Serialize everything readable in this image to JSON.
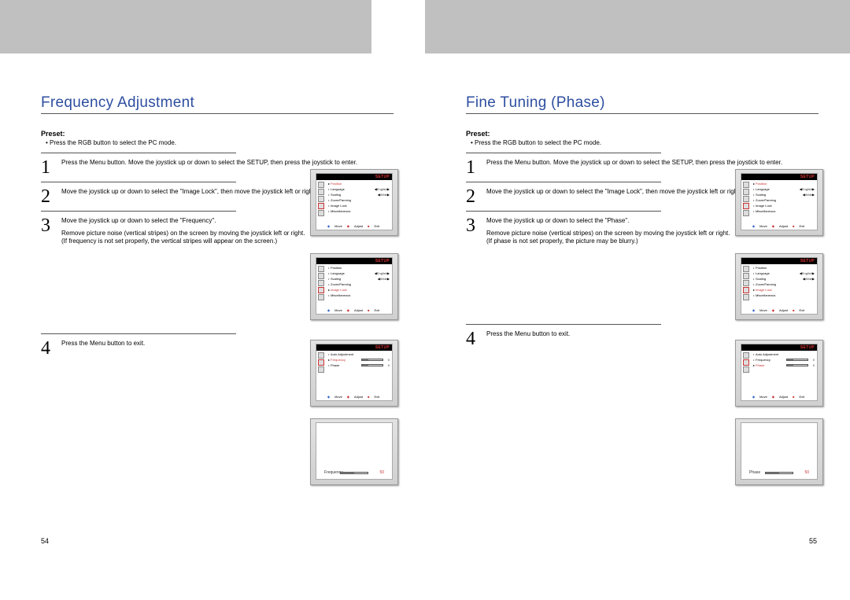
{
  "left": {
    "title": "Frequency Adjustment",
    "presetLabel": "Preset:",
    "presetText": "•   Press the RGB button to select the PC mode.",
    "steps": [
      {
        "num": "1",
        "text": "Press the Menu button. Move the joystick up or down to select the SETUP, then press the joystick to enter."
      },
      {
        "num": "2",
        "text": "Move the joystick up or down to select the \"Image Lock\", then move the joystick left or right to enter."
      },
      {
        "num": "3",
        "text": "Move the joystick up or down to select the \"Frequency\".",
        "extra": "Remove picture noise (vertical stripes) on the screen by moving the joystick left or right.\n(If frequency is not set properly, the vertical stripes will appear on the screen.)"
      },
      {
        "num": "4",
        "text": "Press the Menu button to exit."
      }
    ],
    "pageNum": "54"
  },
  "right": {
    "title": "Fine Tuning (Phase)",
    "presetLabel": "Preset:",
    "presetText": "•   Press the RGB button to select the PC mode.",
    "steps": [
      {
        "num": "1",
        "text": "Press the Menu button. Move the joystick up or down to select the SETUP, then press the joystick to enter."
      },
      {
        "num": "2",
        "text": "Move the joystick up or down to select the \"Image Lock\", then move the joystick left or right to enter."
      },
      {
        "num": "3",
        "text": "Move the joystick up or down to select the \"Phase\".",
        "extra": "Remove picture noise (vertical stripes) on the screen by moving the joystick left or right.\n(If phase is not set properly, the picture may be blurry.)"
      },
      {
        "num": "4",
        "text": "Press the Menu button to exit."
      }
    ],
    "pageNum": "55"
  },
  "osd": {
    "setupLabel": "SETUP",
    "menu1": {
      "items": [
        "Position",
        "Language",
        "Scaling",
        "Zoom/Panning",
        "Image Lock",
        "Miscellaneous"
      ],
      "vals": {
        "Language": "English",
        "Scaling": "Wide"
      },
      "highlight": "Position"
    },
    "menu2": {
      "items": [
        "Position",
        "Language",
        "Scaling",
        "Zoom/Panning",
        "Image Lock",
        "Miscellaneous"
      ],
      "vals": {
        "Language": "English",
        "Scaling": "Wide"
      },
      "highlight": "Image Lock"
    },
    "menu3L": {
      "items": [
        "Auto Adjustment",
        "Frequency",
        "Phase"
      ],
      "bars": {
        "Frequency": "0",
        "Phase": "0"
      },
      "highlight": "Frequency"
    },
    "menu3R": {
      "items": [
        "Auto Adjustment",
        "Frequency",
        "Phase"
      ],
      "bars": {
        "Frequency": "0",
        "Phase": "0"
      },
      "highlight": "Phase"
    },
    "slider4L": {
      "label": "Frequency",
      "value": "50"
    },
    "slider4R": {
      "label": "Phase",
      "value": "50"
    },
    "footer": {
      "move": "Move",
      "adjust": "Adjust",
      "exit": "Exit"
    }
  }
}
